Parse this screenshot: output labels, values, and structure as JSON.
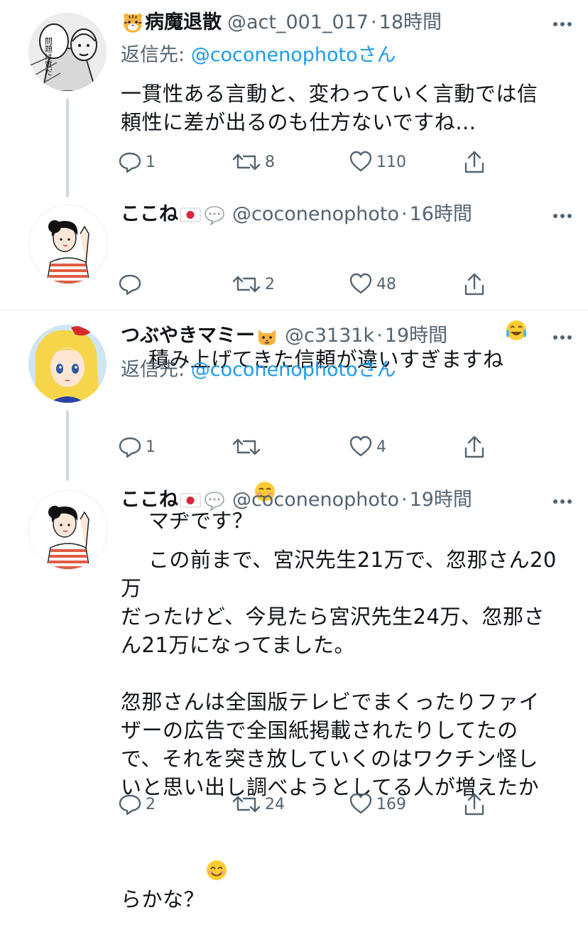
{
  "tweets": [
    {
      "name": "病魔退散",
      "name_emoji": "tiger-face-emoji",
      "handle": "@act_001_017",
      "dot": "·",
      "time": "18時間",
      "reply_prefix": "返信先: ",
      "reply_handle": "@coconenophoto",
      "reply_suffix": "さん",
      "text": "一貫性ある言動と、変わっていく言動では信\n頼性に差が出るのも仕方ないですね…",
      "replies": "1",
      "retweets": "8",
      "likes": "110",
      "avatar_text": "問題は質だ"
    },
    {
      "name": "ここね",
      "name_emoji": "japan-flag-emoji",
      "name_emoji2": "speech-balloon-emoji",
      "handle": "@coconenophoto",
      "dot": "·",
      "time": "16時間",
      "text": "積み上げてきた信頼が違いすぎますね",
      "text_emoji": "tears-of-joy-emoji",
      "replies": "",
      "retweets": "2",
      "likes": "48"
    },
    {
      "name": "つぶやきマミー",
      "name_emoji": "cat-face-emoji",
      "handle": "@c3131k",
      "dot": "·",
      "time": "19時間",
      "reply_prefix": "返信先: ",
      "reply_handle": "@coconenophoto",
      "reply_suffix": "さん",
      "text": "マヂです？",
      "text_emoji": "smiling-face-emoji",
      "replies": "1",
      "retweets": "",
      "likes": "4"
    },
    {
      "name": "ここね",
      "name_emoji": "japan-flag-emoji",
      "name_emoji2": "speech-balloon-emoji",
      "handle": "@coconenophoto",
      "dot": "·",
      "time": "19時間",
      "text": "この前まで、宮沢先生21万で、忽那さん20万\nだったけど、今見たら宮沢先生24万、忽那さ\nん21万になってました。\n\n忽那さんは全国版テレビでまくったりファイ\nザーの広告で全国紙掲載されたりしてたの\nで、それを突き放していくのはワクチン怪し\nいと思い出し調べようとしてる人が増えたか\nらかな？",
      "text_emoji": "smiling-face-with-smiling-eyes-emoji",
      "replies": "2",
      "retweets": "24",
      "likes": "169"
    }
  ],
  "colors": {
    "text": "#0f1419",
    "secondary": "#536471",
    "link": "#1d9bf0",
    "thread_line": "#cfd9de",
    "separator": "#e1e8ed"
  },
  "icons": {
    "reply": "reply-icon",
    "retweet": "retweet-icon",
    "like": "heart-icon",
    "share": "share-icon",
    "more": "more-options-icon"
  }
}
